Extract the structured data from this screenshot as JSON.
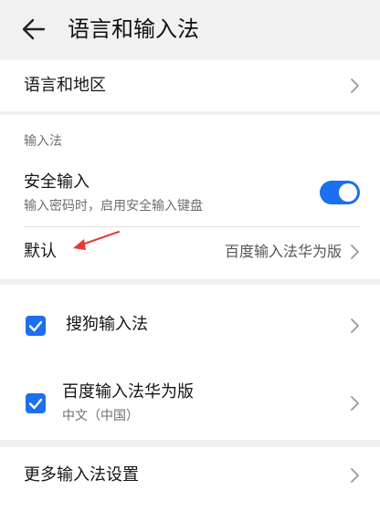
{
  "header": {
    "title": "语言和输入法",
    "back_icon": "arrow-left-icon"
  },
  "language_region": {
    "label": "语言和地区"
  },
  "input_method_section": {
    "title": "输入法",
    "secure_input": {
      "label": "安全输入",
      "description": "输入密码时，启用安全输入键盘",
      "enabled": true
    },
    "default": {
      "label": "默认",
      "value": "百度输入法华为版"
    }
  },
  "keyboards": [
    {
      "label": "搜狗输入法",
      "checked": true
    },
    {
      "label": "百度输入法华为版",
      "sub": "中文（中国）",
      "checked": true
    }
  ],
  "more_settings": {
    "label": "更多输入法设置"
  },
  "colors": {
    "accent": "#1e6ef0",
    "annotation": "#e53935"
  }
}
